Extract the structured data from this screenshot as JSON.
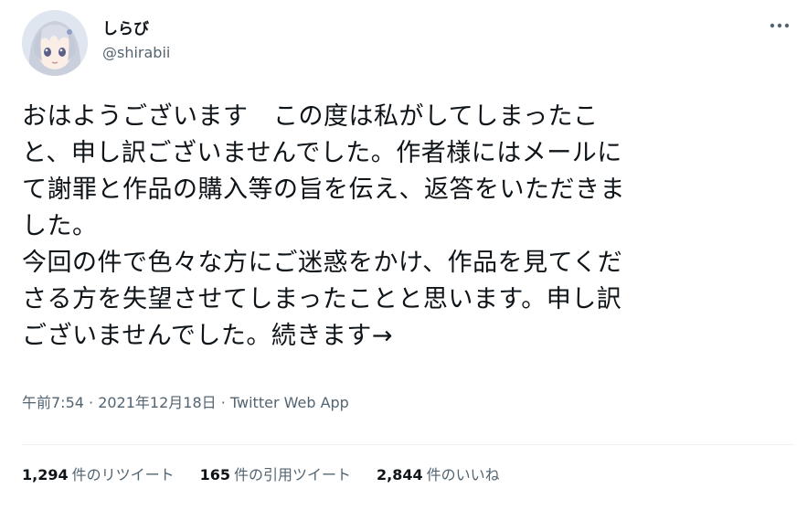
{
  "user": {
    "display_name": "しらび",
    "handle": "@shirabii"
  },
  "tweet": {
    "text": "おはようございます　この度は私がしてしまったこ\nと、申し訳ございませんでした。作者様にはメールに\nて謝罪と作品の購入等の旨を伝え、返答をいただきま\nした。\n今回の件で色々な方にご迷惑をかけ、作品を見てくだ\nさる方を失望させてしまったことと思います。申し訳\nございませんでした。続きます→",
    "meta": "午前7:54 · 2021年12月18日 · ",
    "source": "Twitter Web App"
  },
  "stats": {
    "retweets": {
      "count": "1,294",
      "label": "件のリツイート"
    },
    "quotes": {
      "count": "165",
      "label": "件の引用ツイート"
    },
    "likes": {
      "count": "2,844",
      "label": "件のいいね"
    }
  },
  "icons": {
    "more": "more-dots-icon",
    "avatar": "avatar-illustration"
  },
  "colors": {
    "text_primary": "#0f1419",
    "text_secondary": "#536471",
    "divider": "#eff3f4"
  }
}
